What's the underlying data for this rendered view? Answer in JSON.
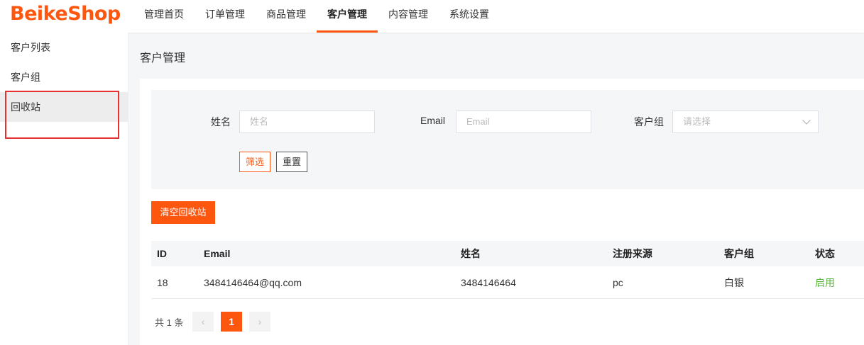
{
  "app": {
    "logo": "BeikeShop"
  },
  "nav": {
    "items": [
      {
        "label": "管理首页"
      },
      {
        "label": "订单管理"
      },
      {
        "label": "商品管理"
      },
      {
        "label": "客户管理"
      },
      {
        "label": "内容管理"
      },
      {
        "label": "系统设置"
      }
    ],
    "active": "客户管理"
  },
  "sidebar": {
    "items": [
      {
        "label": "客户列表"
      },
      {
        "label": "客户组"
      },
      {
        "label": "回收站"
      }
    ],
    "active": "回收站"
  },
  "page": {
    "title": "客户管理"
  },
  "filters": {
    "name_label": "姓名",
    "name_placeholder": "姓名",
    "email_label": "Email",
    "email_placeholder": "Email",
    "group_label": "客户组",
    "group_placeholder": "请选择",
    "filter_button": "筛选",
    "reset_button": "重置"
  },
  "actions": {
    "clear_recycle": "清空回收站"
  },
  "table": {
    "columns": [
      "ID",
      "Email",
      "姓名",
      "注册来源",
      "客户组",
      "状态"
    ],
    "rows": [
      {
        "id": "18",
        "email": "3484146464@qq.com",
        "name": "3484146464",
        "source": "pc",
        "group": "白银",
        "status": "启用"
      }
    ]
  },
  "pagination": {
    "total": "共 1 条",
    "current": "1",
    "prev": "‹",
    "next": "›"
  },
  "colors": {
    "accent": "#fd560f",
    "status_enabled": "#58b23b",
    "highlight": "#e8302f"
  }
}
